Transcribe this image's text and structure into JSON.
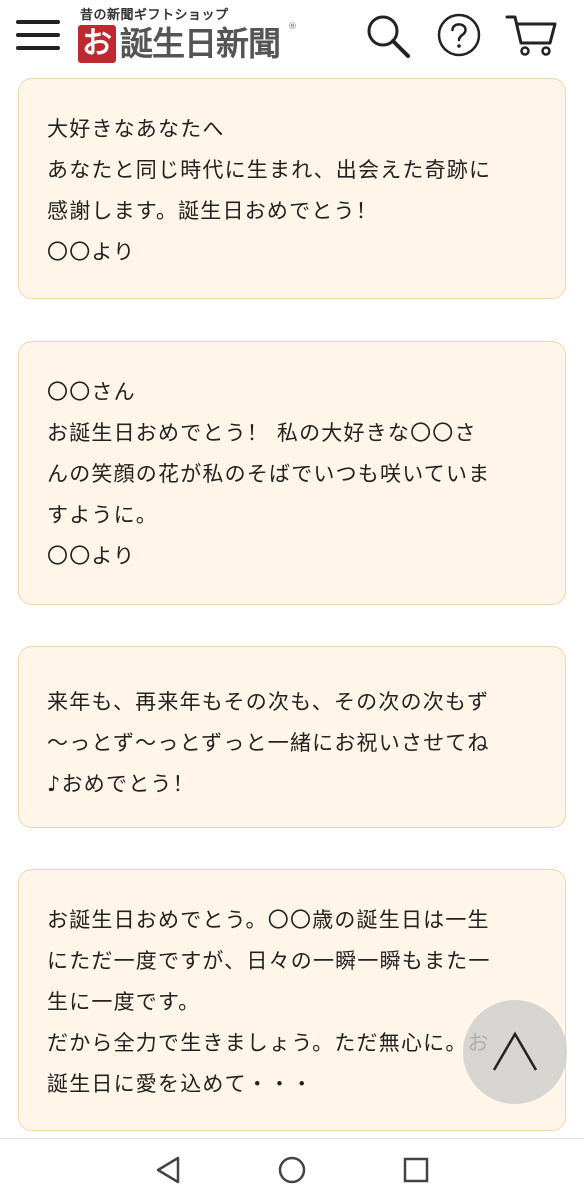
{
  "header": {
    "tagline": "昔の新聞ギフトショップ",
    "logo_mark": "お",
    "logo_name": "誕生日新聞",
    "logo_registered": "®",
    "menu_icon": "hamburger-menu-icon",
    "search_icon": "search-icon",
    "help_icon": "help-circle-icon",
    "cart_icon": "shopping-cart-icon"
  },
  "messages": [
    {
      "lines": [
        "大好きなあなたへ",
        "あなたと同じ時代に生まれ、出会えた奇跡に",
        "感謝します。誕生日おめでとう！",
        "〇〇より"
      ]
    },
    {
      "lines": [
        "〇〇さん",
        "お誕生日おめでとう！ 私の大好きな〇〇さ",
        "んの笑顔の花が私のそばでいつも咲いていま",
        "すように。",
        "〇〇より"
      ]
    },
    {
      "lines": [
        "来年も、再来年もその次も、その次の次もず",
        "〜っとず〜っとずっと一緒にお祝いさせてね",
        "♪おめでとう！"
      ]
    },
    {
      "lines": [
        "お誕生日おめでとう。〇〇歳の誕生日は一生",
        "にただ一度ですが、日々の一瞬一瞬もまた一",
        "生に一度です。",
        "だから全力で生きましょう。ただ無心に。お",
        "誕生日に愛を込めて・・・"
      ]
    }
  ],
  "scroll_top_icon": "chevron-up-icon",
  "nav_bar": {
    "back_icon": "back-triangle-icon",
    "home_icon": "home-circle-icon",
    "recent_icon": "recent-apps-square-icon"
  },
  "colors": {
    "card_background": "#fff6e9",
    "card_border": "#f0d5a8",
    "logo_red": "#c0282f"
  }
}
